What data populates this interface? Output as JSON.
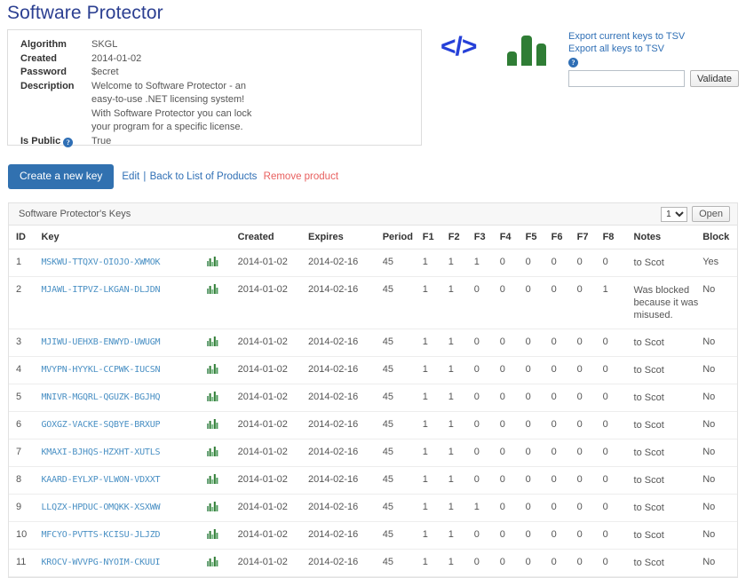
{
  "page_title": "Software Protector",
  "info": {
    "rows": [
      {
        "term": "Algorithm",
        "value": "SKGL"
      },
      {
        "term": "Created",
        "value": "2014-01-02"
      },
      {
        "term": "Password",
        "value": "$ecret"
      }
    ],
    "description_label": "Description",
    "description_lines": [
      "Welcome to Software Protector - an",
      "easy-to-use .NET licensing system!",
      "With Software Protector you can lock",
      "your program for a specific license."
    ],
    "is_public_label": "Is Public",
    "is_public_value": "True",
    "help_glyph": "?"
  },
  "icons": {
    "code_icon": "</>",
    "code_icon_name": "code-brackets-icon",
    "bars_icon_name": "bar-chart-icon"
  },
  "export": {
    "current_link": "Export current keys to TSV",
    "all_link": "Export all keys to TSV",
    "help_glyph": "?",
    "validate_value": "",
    "validate_placeholder": "",
    "validate_button": "Validate"
  },
  "actions": {
    "create_key_button": "Create a new key",
    "edit_link": "Edit",
    "separator": "|",
    "back_link": "Back to List of Products",
    "remove_link": "Remove product"
  },
  "keys_panel": {
    "title": "Software Protector's Keys",
    "page_selected": "1",
    "page_options": [
      "1"
    ],
    "open_button": "Open"
  },
  "table": {
    "headers": {
      "id": "ID",
      "key": "Key",
      "icon": "",
      "created": "Created",
      "expires": "Expires",
      "period": "Period",
      "f1": "F1",
      "f2": "F2",
      "f3": "F3",
      "f4": "F4",
      "f5": "F5",
      "f6": "F6",
      "f7": "F7",
      "f8": "F8",
      "notes": "Notes",
      "block": "Block"
    },
    "rows": [
      {
        "id": "1",
        "key": "MSKWU-TTQXV-OIOJO-XWMOK",
        "created": "2014-01-02",
        "expires": "2014-02-16",
        "period": "45",
        "f": [
          "1",
          "1",
          "1",
          "0",
          "0",
          "0",
          "0",
          "0"
        ],
        "notes": "to Scot",
        "block": "Yes"
      },
      {
        "id": "2",
        "key": "MJAWL-ITPVZ-LKGAN-DLJDN",
        "created": "2014-01-02",
        "expires": "2014-02-16",
        "period": "45",
        "f": [
          "1",
          "1",
          "0",
          "0",
          "0",
          "0",
          "0",
          "1"
        ],
        "notes": "Was blocked because it was misused.",
        "block": "No"
      },
      {
        "id": "3",
        "key": "MJIWU-UEHXB-ENWYD-UWUGM",
        "created": "2014-01-02",
        "expires": "2014-02-16",
        "period": "45",
        "f": [
          "1",
          "1",
          "0",
          "0",
          "0",
          "0",
          "0",
          "0"
        ],
        "notes": "to Scot",
        "block": "No"
      },
      {
        "id": "4",
        "key": "MVYPN-HYYKL-CCPWK-IUCSN",
        "created": "2014-01-02",
        "expires": "2014-02-16",
        "period": "45",
        "f": [
          "1",
          "1",
          "0",
          "0",
          "0",
          "0",
          "0",
          "0"
        ],
        "notes": "to Scot",
        "block": "No"
      },
      {
        "id": "5",
        "key": "MNIVR-MGQRL-QGUZK-BGJHQ",
        "created": "2014-01-02",
        "expires": "2014-02-16",
        "period": "45",
        "f": [
          "1",
          "1",
          "0",
          "0",
          "0",
          "0",
          "0",
          "0"
        ],
        "notes": "to Scot",
        "block": "No"
      },
      {
        "id": "6",
        "key": "GOXGZ-VACKE-SQBYE-BRXUP",
        "created": "2014-01-02",
        "expires": "2014-02-16",
        "period": "45",
        "f": [
          "1",
          "1",
          "0",
          "0",
          "0",
          "0",
          "0",
          "0"
        ],
        "notes": "to Scot",
        "block": "No"
      },
      {
        "id": "7",
        "key": "KMAXI-BJHQS-HZXHT-XUTLS",
        "created": "2014-01-02",
        "expires": "2014-02-16",
        "period": "45",
        "f": [
          "1",
          "1",
          "0",
          "0",
          "0",
          "0",
          "0",
          "0"
        ],
        "notes": "to Scot",
        "block": "No"
      },
      {
        "id": "8",
        "key": "KAARD-EYLXP-VLWON-VDXXT",
        "created": "2014-01-02",
        "expires": "2014-02-16",
        "period": "45",
        "f": [
          "1",
          "1",
          "0",
          "0",
          "0",
          "0",
          "0",
          "0"
        ],
        "notes": "to Scot",
        "block": "No"
      },
      {
        "id": "9",
        "key": "LLQZX-HPDUC-OMQKK-XSXWW",
        "created": "2014-01-02",
        "expires": "2014-02-16",
        "period": "45",
        "f": [
          "1",
          "1",
          "1",
          "0",
          "0",
          "0",
          "0",
          "0"
        ],
        "notes": "to Scot",
        "block": "No"
      },
      {
        "id": "10",
        "key": "MFCYO-PVTTS-KCISU-JLJZD",
        "created": "2014-01-02",
        "expires": "2014-02-16",
        "period": "45",
        "f": [
          "1",
          "1",
          "0",
          "0",
          "0",
          "0",
          "0",
          "0"
        ],
        "notes": "to Scot",
        "block": "No"
      },
      {
        "id": "11",
        "key": "KROCV-WVVPG-NYOIM-CKUUI",
        "created": "2014-01-02",
        "expires": "2014-02-16",
        "period": "45",
        "f": [
          "1",
          "1",
          "0",
          "0",
          "0",
          "0",
          "0",
          "0"
        ],
        "notes": "to Scot",
        "block": "No"
      }
    ]
  },
  "colors": {
    "title": "#2b3f91",
    "link": "#2f6fb5",
    "key_link": "#4a90c4",
    "primary_button": "#3171b0",
    "danger": "#e8605f",
    "block_yes": "#f26b6b",
    "block_no": "#3f9e52",
    "bars_green": "#2f7d35",
    "code_blue": "#2540d8"
  }
}
